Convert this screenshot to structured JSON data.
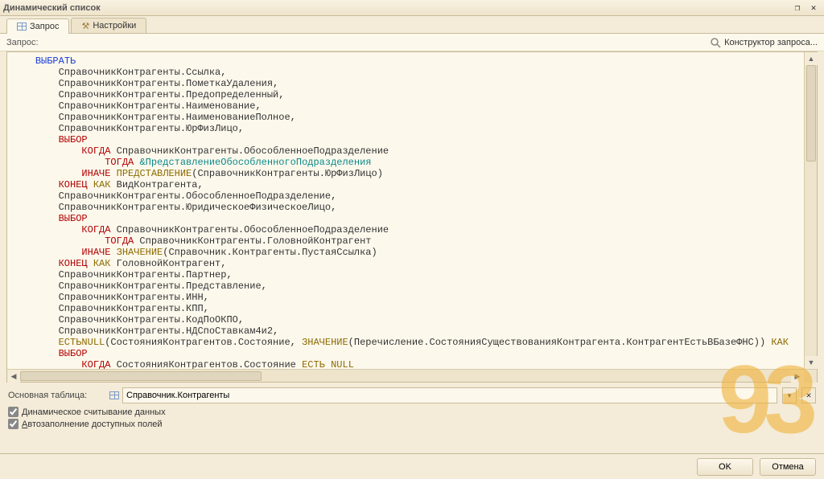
{
  "window": {
    "title": "Динамический список",
    "restore_tip": "Restore",
    "close_tip": "Close"
  },
  "tabs": {
    "query": "Запрос",
    "settings": "Настройки"
  },
  "toolbar": {
    "query_label": "Запрос:",
    "constructor_label": "Конструктор запроса..."
  },
  "code": {
    "lines": [
      {
        "indent": 1,
        "tokens": [
          {
            "t": "ВЫБРАТЬ",
            "c": "kw-blue"
          }
        ]
      },
      {
        "indent": 2,
        "tokens": [
          {
            "t": "СправочникКонтрагенты.Ссылка,"
          }
        ]
      },
      {
        "indent": 2,
        "tokens": [
          {
            "t": "СправочникКонтрагенты.ПометкаУдаления,"
          }
        ]
      },
      {
        "indent": 2,
        "tokens": [
          {
            "t": "СправочникКонтрагенты.Предопределенный,"
          }
        ]
      },
      {
        "indent": 2,
        "tokens": [
          {
            "t": "СправочникКонтрагенты.Наименование,"
          }
        ]
      },
      {
        "indent": 2,
        "tokens": [
          {
            "t": "СправочникКонтрагенты.НаименованиеПолное,"
          }
        ]
      },
      {
        "indent": 2,
        "tokens": [
          {
            "t": "СправочникКонтрагенты.ЮрФизЛицо,"
          }
        ]
      },
      {
        "indent": 2,
        "tokens": [
          {
            "t": "ВЫБОР",
            "c": "kw-red"
          }
        ]
      },
      {
        "indent": 3,
        "tokens": [
          {
            "t": "КОГДА",
            "c": "kw-red"
          },
          {
            "t": " СправочникКонтрагенты.ОбособленноеПодразделение"
          }
        ]
      },
      {
        "indent": 4,
        "tokens": [
          {
            "t": "ТОГДА",
            "c": "kw-red"
          },
          {
            "t": " "
          },
          {
            "t": "&ПредставлениеОбособленногоПодразделения",
            "c": "kw-teal"
          }
        ]
      },
      {
        "indent": 3,
        "tokens": [
          {
            "t": "ИНАЧЕ",
            "c": "kw-red"
          },
          {
            "t": " "
          },
          {
            "t": "ПРЕДСТАВЛЕНИЕ",
            "c": "kw-brown"
          },
          {
            "t": "(СправочникКонтрагенты.ЮрФизЛицо)"
          }
        ]
      },
      {
        "indent": 2,
        "tokens": [
          {
            "t": "КОНЕЦ",
            "c": "kw-red"
          },
          {
            "t": " "
          },
          {
            "t": "КАК",
            "c": "kw-brown"
          },
          {
            "t": " ВидКонтрагента,"
          }
        ]
      },
      {
        "indent": 2,
        "tokens": [
          {
            "t": "СправочникКонтрагенты.ОбособленноеПодразделение,"
          }
        ]
      },
      {
        "indent": 2,
        "tokens": [
          {
            "t": "СправочникКонтрагенты.ЮридическоеФизическоеЛицо,"
          }
        ]
      },
      {
        "indent": 2,
        "tokens": [
          {
            "t": "ВЫБОР",
            "c": "kw-red"
          }
        ]
      },
      {
        "indent": 3,
        "tokens": [
          {
            "t": "КОГДА",
            "c": "kw-red"
          },
          {
            "t": " СправочникКонтрагенты.ОбособленноеПодразделение"
          }
        ]
      },
      {
        "indent": 4,
        "tokens": [
          {
            "t": "ТОГДА",
            "c": "kw-red"
          },
          {
            "t": " СправочникКонтрагенты.ГоловнойКонтрагент"
          }
        ]
      },
      {
        "indent": 3,
        "tokens": [
          {
            "t": "ИНАЧЕ",
            "c": "kw-red"
          },
          {
            "t": " "
          },
          {
            "t": "ЗНАЧЕНИЕ",
            "c": "kw-brown"
          },
          {
            "t": "(Справочник.Контрагенты.ПустаяСсылка)"
          }
        ]
      },
      {
        "indent": 2,
        "tokens": [
          {
            "t": "КОНЕЦ",
            "c": "kw-red"
          },
          {
            "t": " "
          },
          {
            "t": "КАК",
            "c": "kw-brown"
          },
          {
            "t": " ГоловнойКонтрагент,"
          }
        ]
      },
      {
        "indent": 2,
        "tokens": [
          {
            "t": "СправочникКонтрагенты.Партнер,"
          }
        ]
      },
      {
        "indent": 2,
        "tokens": [
          {
            "t": "СправочникКонтрагенты.Представление,"
          }
        ]
      },
      {
        "indent": 2,
        "tokens": [
          {
            "t": "СправочникКонтрагенты.ИНН,"
          }
        ]
      },
      {
        "indent": 2,
        "tokens": [
          {
            "t": "СправочникКонтрагенты.КПП,"
          }
        ]
      },
      {
        "indent": 2,
        "tokens": [
          {
            "t": "СправочникКонтрагенты.КодПоОКПО,"
          }
        ]
      },
      {
        "indent": 2,
        "tokens": [
          {
            "t": "СправочникКонтрагенты.НДСпоСтавкам4и2,"
          }
        ]
      },
      {
        "indent": 2,
        "tokens": [
          {
            "t": "ЕСТЬNULL",
            "c": "kw-brown"
          },
          {
            "t": "(СостоянияКонтрагентов.Состояние, "
          },
          {
            "t": "ЗНАЧЕНИЕ",
            "c": "kw-brown"
          },
          {
            "t": "(Перечисление.СостоянияСуществованияКонтрагента.КонтрагентЕстьВБазеФНС)) "
          },
          {
            "t": "КАК",
            "c": "kw-brown"
          }
        ]
      },
      {
        "indent": 2,
        "tokens": [
          {
            "t": "ВЫБОР",
            "c": "kw-red"
          }
        ]
      },
      {
        "indent": 3,
        "tokens": [
          {
            "t": "КОГДА",
            "c": "kw-red"
          },
          {
            "t": " СостоянияКонтрагентов.Состояние "
          },
          {
            "t": "ЕСТЬ",
            "c": "kw-brown"
          },
          {
            "t": " "
          },
          {
            "t": "NULL",
            "c": "kw-brown"
          }
        ]
      }
    ]
  },
  "main_table": {
    "label": "Основная таблица:",
    "value": "Справочник.Контрагенты"
  },
  "checks": {
    "dynamic_prefix": "Д",
    "dynamic_rest": "инамическое считывание данных",
    "autofill_prefix": "А",
    "autofill_rest": "втозаполнение доступных полей"
  },
  "footer": {
    "ok": "OK",
    "cancel": "Отмена"
  },
  "watermark": "93"
}
